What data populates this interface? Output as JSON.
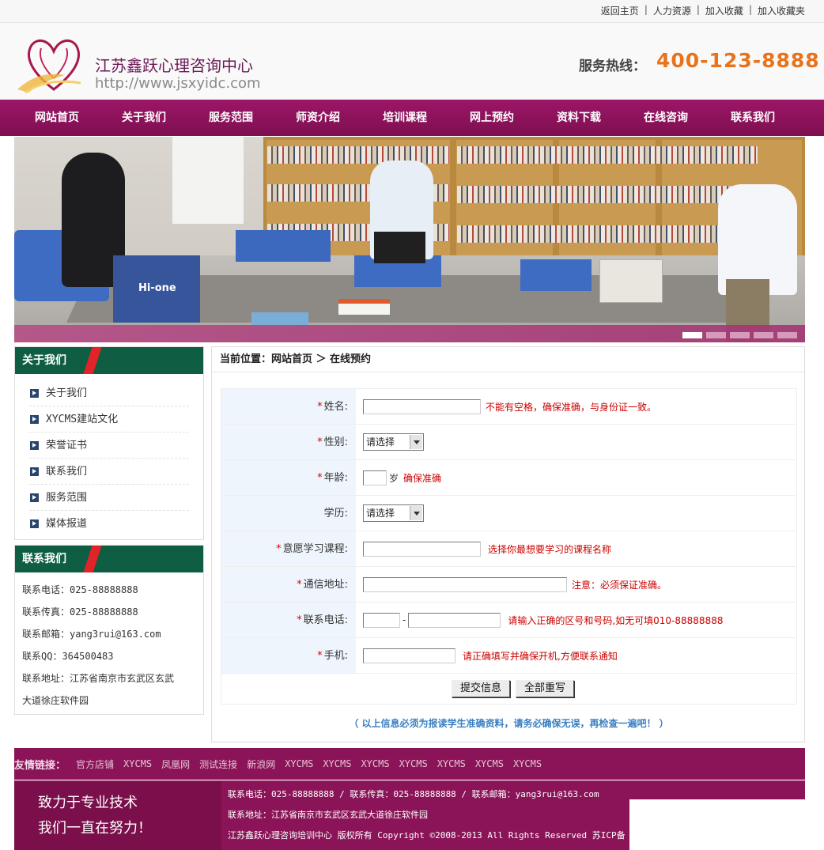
{
  "toplinks": [
    "返回主页",
    "人力资源",
    "加入收藏",
    "加入收藏夹"
  ],
  "header": {
    "title": "江苏鑫跃心理咨询中心",
    "url": "http://www.jsxyidc.com",
    "hotline_label": "服务热线：",
    "hotline": "400-123-8888"
  },
  "nav": [
    "网站首页",
    "关于我们",
    "服务范围",
    "师资介绍",
    "培训课程",
    "网上预约",
    "资料下载",
    "在线咨询",
    "联系我们"
  ],
  "banner": {
    "slides": 5,
    "active_slide": 1,
    "bag_text": "Hi-one"
  },
  "sidebar": {
    "about_title": "关于我们",
    "about_items": [
      "关于我们",
      "XYCMS建站文化",
      "荣誉证书",
      "联系我们",
      "服务范围",
      "媒体报道"
    ],
    "contact_title": "联系我们",
    "contact_lines": [
      "联系电话：025-88888888",
      "联系传真：025-88888888",
      "联系邮箱：yang3rui@163.com",
      "联系QQ：364500483",
      "联系地址：江苏省南京市玄武区玄武",
      "大道徐庄软件园"
    ]
  },
  "main": {
    "breadcrumb": "当前位置：网站首页 ＞ 在线预约",
    "form": {
      "name_label": "姓名:",
      "name_hint": "不能有空格，确保准确，与身份证一致。",
      "gender_label": "性别:",
      "gender_value": "请选择",
      "age_label": "年龄:",
      "age_unit": "岁",
      "age_hint": "确保准确",
      "edu_label": "学历:",
      "edu_value": "请选择",
      "course_label": "意愿学习课程:",
      "course_hint": "选择你最想要学习的课程名称",
      "address_label": "通信地址:",
      "address_hint": "注意：必须保证准确。",
      "phone_label": "联系电话:",
      "phone_hint": "请输入正确的区号和号码,如无可填010-88888888",
      "mobile_label": "手机:",
      "mobile_hint": "请正确填写并确保开机,方便联系通知",
      "required_mark": "*",
      "submit": "提交信息",
      "reset": "全部重写"
    },
    "notice": "（ 以上信息必须为报读学生准确资料，请务必确保无误，再检查一遍吧！ ）"
  },
  "footer": {
    "friend_label": "友情链接：",
    "friend_links": [
      "官方店铺",
      "XYCMS",
      "凤凰网",
      "测试连接",
      "新浪网",
      "XYCMS",
      "XYCMS",
      "XYCMS",
      "XYCMS",
      "XYCMS",
      "XYCMS",
      "XYCMS"
    ],
    "slogan_1": "致力于专业技术",
    "slogan_2": "我们一直在努力！",
    "info_1": "联系电话：025-88888888 / 联系传真：025-88888888 / 联系邮箱：yang3rui@163.com",
    "info_2": "联系地址：江苏省南京市玄武区玄武大道徐庄软件园",
    "info_3": "江苏鑫跃心理咨询培训中心 版权所有 Copyright ©2008-2013 All Rights Reserved   苏ICP备"
  },
  "colors": {
    "brand": "#8a1457",
    "green": "#0f5e43",
    "hotline": "#e8731c",
    "hint": "#cc0000",
    "notice": "#3a7fc0"
  }
}
